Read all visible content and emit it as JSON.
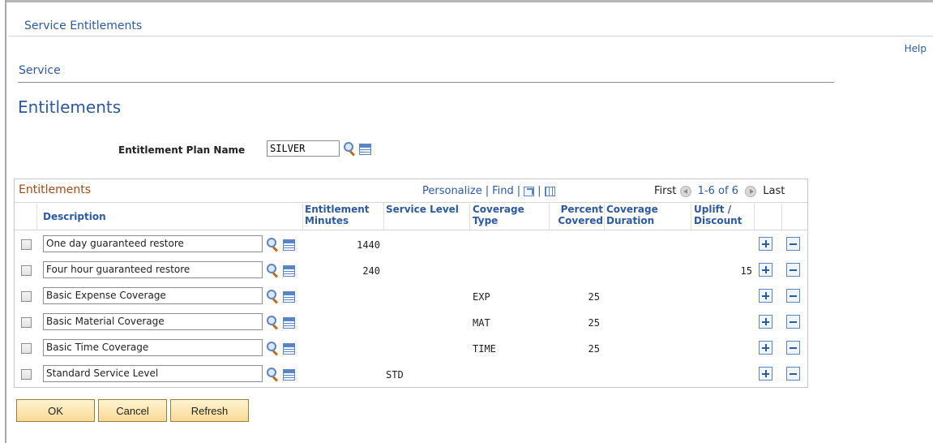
{
  "window": {
    "title": "Service Entitlements"
  },
  "header": {
    "help": "Help"
  },
  "section": {
    "label": "Service",
    "page_title": "Entitlements"
  },
  "plan": {
    "label": "Entitlement Plan Name",
    "value": "SILVER"
  },
  "grid": {
    "title": "Entitlements",
    "personalize": "Personalize",
    "find": "Find",
    "nav_first": "First",
    "nav_count": "1-6 of 6",
    "nav_last": "Last",
    "columns": {
      "description": "Description",
      "entitlement_minutes": "Entitlement Minutes",
      "service_level": "Service Level",
      "coverage_type": "Coverage Type",
      "percent_covered": "Percent Covered",
      "coverage_duration": "Coverage Duration",
      "uplift_discount": "Uplift / Discount"
    },
    "rows": [
      {
        "description": "One day guaranteed restore",
        "minutes": "1440",
        "service_level": "",
        "coverage_type": "",
        "percent": "",
        "duration": "",
        "uplift": ""
      },
      {
        "description": "Four hour guaranteed restore",
        "minutes": "240",
        "service_level": "",
        "coverage_type": "",
        "percent": "",
        "duration": "",
        "uplift": "15"
      },
      {
        "description": "Basic Expense Coverage",
        "minutes": "",
        "service_level": "",
        "coverage_type": "EXP",
        "percent": "25",
        "duration": "",
        "uplift": ""
      },
      {
        "description": "Basic Material Coverage",
        "minutes": "",
        "service_level": "",
        "coverage_type": "MAT",
        "percent": "25",
        "duration": "",
        "uplift": ""
      },
      {
        "description": "Basic Time Coverage",
        "minutes": "",
        "service_level": "",
        "coverage_type": "TIME",
        "percent": "25",
        "duration": "",
        "uplift": ""
      },
      {
        "description": "Standard Service Level",
        "minutes": "",
        "service_level": "STD",
        "coverage_type": "",
        "percent": "",
        "duration": "",
        "uplift": ""
      }
    ]
  },
  "buttons": {
    "ok": "OK",
    "cancel": "Cancel",
    "refresh": "Refresh"
  },
  "colors": {
    "link": "#2c5aa0",
    "grid_title": "#a04a14",
    "button": "#f9d996"
  }
}
